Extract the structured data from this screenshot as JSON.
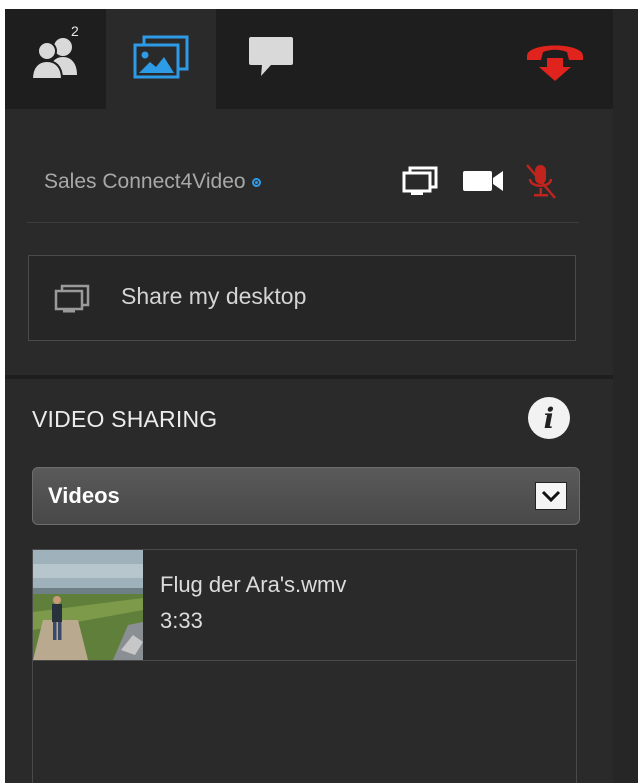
{
  "tabs": {
    "participants_count": "2",
    "active_tab": "media"
  },
  "participant": {
    "name": "Sales Connect4Video",
    "status_color": "#2e9be6"
  },
  "share_desktop": {
    "label": "Share my desktop"
  },
  "video_sharing": {
    "title": "VIDEO SHARING",
    "dropdown_value": "Videos",
    "items": [
      {
        "title": "Flug der Ara's.wmv",
        "duration": "3:33"
      }
    ]
  },
  "colors": {
    "accent": "#2e9be6",
    "hangup": "#e0231c",
    "mic_muted": "#c0241c"
  }
}
